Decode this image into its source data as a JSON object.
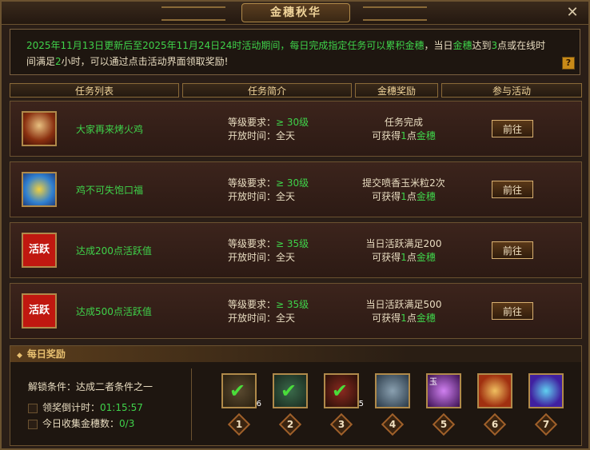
{
  "window": {
    "title": "金穗秋华",
    "close_symbol": "✕"
  },
  "notice": {
    "p1": "2025年11月13日更新后至2025年11月24日24时活动期间，每日完成指定任务可以累积",
    "p2": "金穗",
    "p3": "，当日",
    "p4": "金穗",
    "p5": "达到",
    "p6": "3",
    "p7": "点或在线时间满足",
    "p8": "2",
    "p9": "小时，可以通过点击活动界面领取奖励!",
    "help_symbol": "?"
  },
  "headers": [
    "任务列表",
    "任务简介",
    "金穗奖励",
    "参与活动"
  ],
  "tasks": [
    {
      "icon": "roast-chicken-icon",
      "name": "大家再来烤火鸡",
      "req_label": "等级要求：",
      "req_value": "≥ 30级",
      "time_label": "开放时间：",
      "time_value": "全天",
      "reward_l1": "任务完成",
      "reward_pre": "可获得",
      "reward_n": "1",
      "reward_unit": "点",
      "reward_item": "金穗",
      "button": "前往"
    },
    {
      "icon": "chicken-feast-icon",
      "name": "鸡不可失饱口福",
      "req_label": "等级要求：",
      "req_value": "≥ 30级",
      "time_label": "开放时间：",
      "time_value": "全天",
      "reward_l1": "提交喷香玉米粒2次",
      "reward_pre": "可获得",
      "reward_n": "1",
      "reward_unit": "点",
      "reward_item": "金穗",
      "button": "前往"
    },
    {
      "icon": "activity-icon",
      "icon_text": "活跃",
      "name": "达成200点活跃值",
      "req_label": "等级要求：",
      "req_value": "≥ 35级",
      "time_label": "开放时间：",
      "time_value": "全天",
      "reward_l1": "当日活跃满足200",
      "reward_pre": "可获得",
      "reward_n": "1",
      "reward_unit": "点",
      "reward_item": "金穗",
      "button": "前往"
    },
    {
      "icon": "activity-icon",
      "icon_text": "活跃",
      "name": "达成500点活跃值",
      "req_label": "等级要求：",
      "req_value": "≥ 35级",
      "time_label": "开放时间：",
      "time_value": "全天",
      "reward_l1": "当日活跃满足500",
      "reward_pre": "可获得",
      "reward_n": "1",
      "reward_unit": "点",
      "reward_item": "金穗",
      "button": "前往"
    }
  ],
  "daily": {
    "title": "每日奖励",
    "unlock": "解锁条件：达成二者条件之一",
    "countdown_label": "领奖倒计时：",
    "countdown_value": "01:15:57",
    "collect_label": "今日收集金穗数：",
    "collect_value": "0/3",
    "rewards": [
      {
        "num": "1",
        "count": "6",
        "claimed": true
      },
      {
        "num": "2",
        "count": "",
        "claimed": true
      },
      {
        "num": "3",
        "count": "5",
        "claimed": true
      },
      {
        "num": "4",
        "count": "",
        "claimed": false
      },
      {
        "num": "5",
        "count": "",
        "claimed": false,
        "tag": "玉"
      },
      {
        "num": "6",
        "count": "",
        "claimed": false
      },
      {
        "num": "7",
        "count": "",
        "claimed": false
      }
    ],
    "check_symbol": "✔"
  }
}
